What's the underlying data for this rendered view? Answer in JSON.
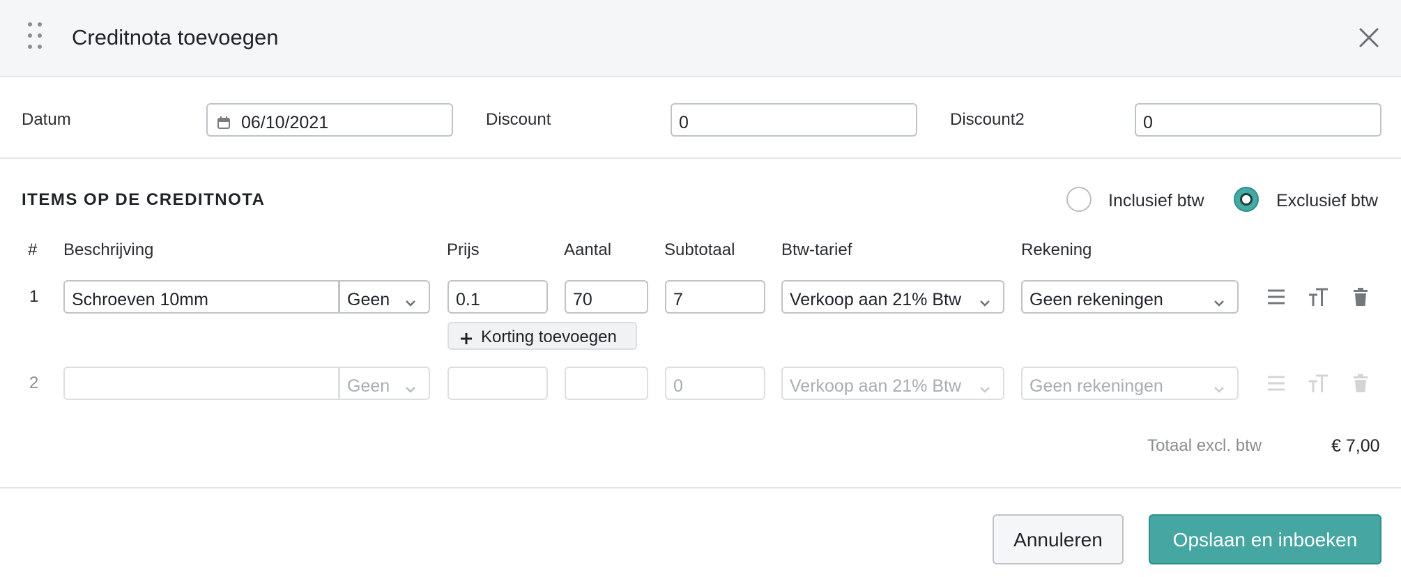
{
  "dialog": {
    "title": "Creditnota toevoegen"
  },
  "form": {
    "datum_label": "Datum",
    "datum_value": "06/10/2021",
    "discount_label": "Discount",
    "discount_value": "0",
    "discount2_label": "Discount2",
    "discount2_value": "0"
  },
  "items": {
    "section_title": "ITEMS OP DE CREDITNOTA",
    "vat_mode": {
      "options": [
        "Inclusief btw",
        "Exclusief btw"
      ],
      "selected": "Exclusief btw"
    },
    "columns": {
      "number": "#",
      "description": "Beschrijving",
      "price": "Prijs",
      "quantity": "Aantal",
      "subtotal": "Subtotaal",
      "vat_rate": "Btw-tarief",
      "account": "Rekening"
    },
    "rows": [
      {
        "number": "1",
        "description": "Schroeven 10mm",
        "unit": "Geen",
        "price": "0.1",
        "quantity": "70",
        "subtotal": "7",
        "vat_rate": "Verkoop aan 21% Btw",
        "account": "Geen rekeningen",
        "add_discount_label": "Korting toevoegen"
      },
      {
        "number": "2",
        "description": "",
        "unit": "Geen",
        "price": "",
        "quantity": "",
        "subtotal": "0",
        "vat_rate": "Verkoop aan 21% Btw",
        "account": "Geen rekeningen"
      }
    ],
    "total_label": "Totaal excl. btw",
    "total_value": "€ 7,00"
  },
  "footer": {
    "cancel_label": "Annuleren",
    "save_label": "Opslaan en inboeken"
  },
  "colors": {
    "accent": "#45a6a2",
    "header_bg": "#f5f6f7"
  },
  "icons": {
    "drag": "drag-handle-icon",
    "close": "close-icon",
    "calendar": "calendar-icon",
    "chevron": "chevron-down-icon",
    "plus": "plus-icon",
    "description_lines": "lines-icon",
    "text_size": "text-size-icon",
    "delete": "trash-icon"
  }
}
